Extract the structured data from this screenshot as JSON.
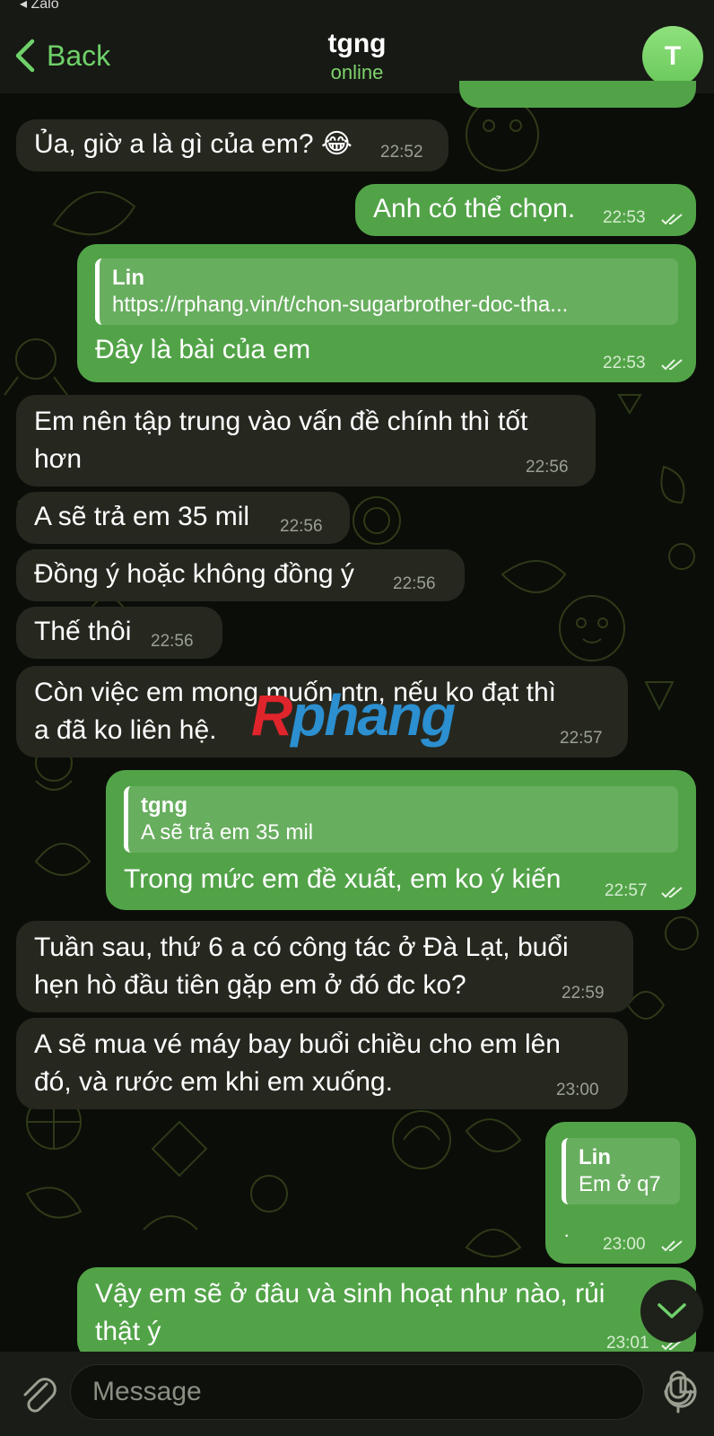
{
  "status_bar": {
    "back_app": "◂ Zalo"
  },
  "header": {
    "back_label": "Back",
    "title": "tgng",
    "status": "online",
    "avatar_letter": "T"
  },
  "messages": [
    {
      "dir": "in",
      "text": "Ủa, giờ a là gì của em? 😂",
      "time": "22:52"
    },
    {
      "dir": "out",
      "text": "Anh có thể chọn.",
      "time": "22:53"
    },
    {
      "dir": "out",
      "reply_name": "Lin",
      "reply_text": "https://rphang.vin/t/chon-sugarbrother-doc-tha...",
      "text": "Đây là bài của em",
      "time": "22:53"
    },
    {
      "dir": "in",
      "text_lines": [
        "Em nên tập trung vào vấn đề chính thì tốt",
        "hơn"
      ],
      "time": "22:56"
    },
    {
      "dir": "in",
      "text": "A sẽ trả em 35 mil",
      "time": "22:56"
    },
    {
      "dir": "in",
      "text": "Đồng ý hoặc không đồng ý",
      "time": "22:56"
    },
    {
      "dir": "in",
      "text": "Thế thôi",
      "time": "22:56"
    },
    {
      "dir": "in",
      "text_lines": [
        "Còn việc em mong muốn ntn, nếu ko đạt thì",
        "a đã ko liên hệ."
      ],
      "time": "22:57"
    },
    {
      "dir": "out",
      "reply_name": "tgng",
      "reply_text": "A sẽ trả em 35 mil",
      "text": "Trong mức em đề xuất, em ko ý kiến",
      "time": "22:57"
    },
    {
      "dir": "in",
      "text_lines": [
        "Tuần sau, thứ 6 a có công tác ở Đà Lạt, buổi",
        "hẹn hò đầu tiên gặp em ở đó đc ko?"
      ],
      "time": "22:59"
    },
    {
      "dir": "in",
      "text_lines": [
        "A sẽ mua vé máy bay buổi chiều cho em lên",
        "đó, và rước em khi em xuống."
      ],
      "time": "23:00"
    },
    {
      "dir": "out",
      "reply_name": "Lin",
      "reply_text": "Em ở q7",
      "text": "·",
      "time": "23:00"
    },
    {
      "dir": "out",
      "text_lines": [
        "Vậy em sẽ ở đâu và sinh hoạt như nào, rủi",
        "thật ý"
      ],
      "time": "23:01"
    }
  ],
  "watermark": {
    "first": "R",
    "rest": "phang"
  },
  "input": {
    "placeholder": "Message"
  },
  "colors": {
    "accent": "#6fd16a",
    "outgoing_bubble": "#52a348",
    "incoming_bubble": "#262820",
    "background": "#0b0d08"
  },
  "icons": [
    "back-chevron-icon",
    "attach-icon",
    "sticker-icon",
    "mic-icon",
    "chevron-down-icon",
    "double-check-icon"
  ]
}
